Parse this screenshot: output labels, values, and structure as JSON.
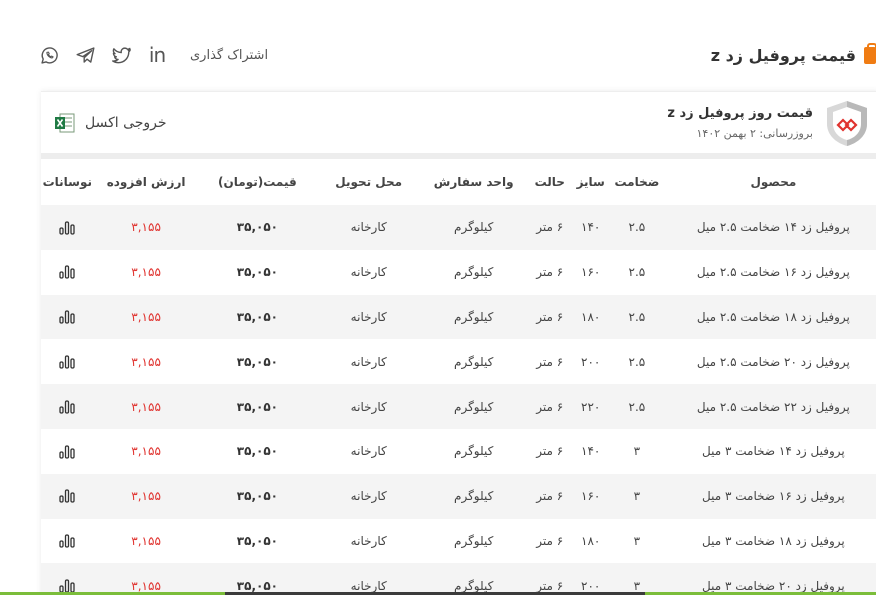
{
  "page": {
    "title": "قیمت پروفیل زد z",
    "share_label": "اشتراک گذاری",
    "share_icons": [
      "linkedin-icon",
      "twitter-icon",
      "telegram-icon",
      "whatsapp-icon"
    ],
    "linkedin_text": "in"
  },
  "card": {
    "title": "قیمت روز پروفیل زد z",
    "updated": "بروزرسانی: ۲ بهمن ۱۴۰۲",
    "excel_label": "خروجی اکسل"
  },
  "table": {
    "headers": {
      "product": "محصول",
      "thickness": "ضخامت",
      "size": "سایز",
      "state": "حالت",
      "unit": "واحد سفارش",
      "delivery": "محل تحویل",
      "price": "قیمت(تومان)",
      "vat": "ارزش افزوده",
      "changes": "نوسانات"
    },
    "rows": [
      {
        "product": "پروفیل زد ۱۴ ضخامت ۲.۵ میل",
        "thickness": "۲.۵",
        "size": "۱۴۰",
        "state": "۶ متر",
        "unit": "کیلوگرم",
        "delivery": "کارخانه",
        "price": "۳۵,۰۵۰",
        "vat": "۳,۱۵۵"
      },
      {
        "product": "پروفیل زد ۱۶ ضخامت ۲.۵ میل",
        "thickness": "۲.۵",
        "size": "۱۶۰",
        "state": "۶ متر",
        "unit": "کیلوگرم",
        "delivery": "کارخانه",
        "price": "۳۵,۰۵۰",
        "vat": "۳,۱۵۵"
      },
      {
        "product": "پروفیل زد ۱۸ ضخامت ۲.۵ میل",
        "thickness": "۲.۵",
        "size": "۱۸۰",
        "state": "۶ متر",
        "unit": "کیلوگرم",
        "delivery": "کارخانه",
        "price": "۳۵,۰۵۰",
        "vat": "۳,۱۵۵"
      },
      {
        "product": "پروفیل زد ۲۰ ضخامت ۲.۵ میل",
        "thickness": "۲.۵",
        "size": "۲۰۰",
        "state": "۶ متر",
        "unit": "کیلوگرم",
        "delivery": "کارخانه",
        "price": "۳۵,۰۵۰",
        "vat": "۳,۱۵۵"
      },
      {
        "product": "پروفیل زد ۲۲ ضخامت ۲.۵ میل",
        "thickness": "۲.۵",
        "size": "۲۲۰",
        "state": "۶ متر",
        "unit": "کیلوگرم",
        "delivery": "کارخانه",
        "price": "۳۵,۰۵۰",
        "vat": "۳,۱۵۵"
      },
      {
        "product": "پروفیل زد ۱۴ ضخامت ۳ میل",
        "thickness": "۳",
        "size": "۱۴۰",
        "state": "۶ متر",
        "unit": "کیلوگرم",
        "delivery": "کارخانه",
        "price": "۳۵,۰۵۰",
        "vat": "۳,۱۵۵"
      },
      {
        "product": "پروفیل زد ۱۶ ضخامت ۳ میل",
        "thickness": "۳",
        "size": "۱۶۰",
        "state": "۶ متر",
        "unit": "کیلوگرم",
        "delivery": "کارخانه",
        "price": "۳۵,۰۵۰",
        "vat": "۳,۱۵۵"
      },
      {
        "product": "پروفیل زد ۱۸ ضخامت ۳ میل",
        "thickness": "۳",
        "size": "۱۸۰",
        "state": "۶ متر",
        "unit": "کیلوگرم",
        "delivery": "کارخانه",
        "price": "۳۵,۰۵۰",
        "vat": "۳,۱۵۵"
      },
      {
        "product": "پروفیل زد ۲۰ ضخامت ۳ میل",
        "thickness": "۳",
        "size": "۲۰۰",
        "state": "۶ متر",
        "unit": "کیلوگرم",
        "delivery": "کارخانه",
        "price": "۳۵,۰۵۰",
        "vat": "۳,۱۵۵"
      }
    ]
  },
  "colors": {
    "accent": "#f07c13",
    "vat": "#e0322e",
    "row_alt": "#f4f4f4"
  }
}
